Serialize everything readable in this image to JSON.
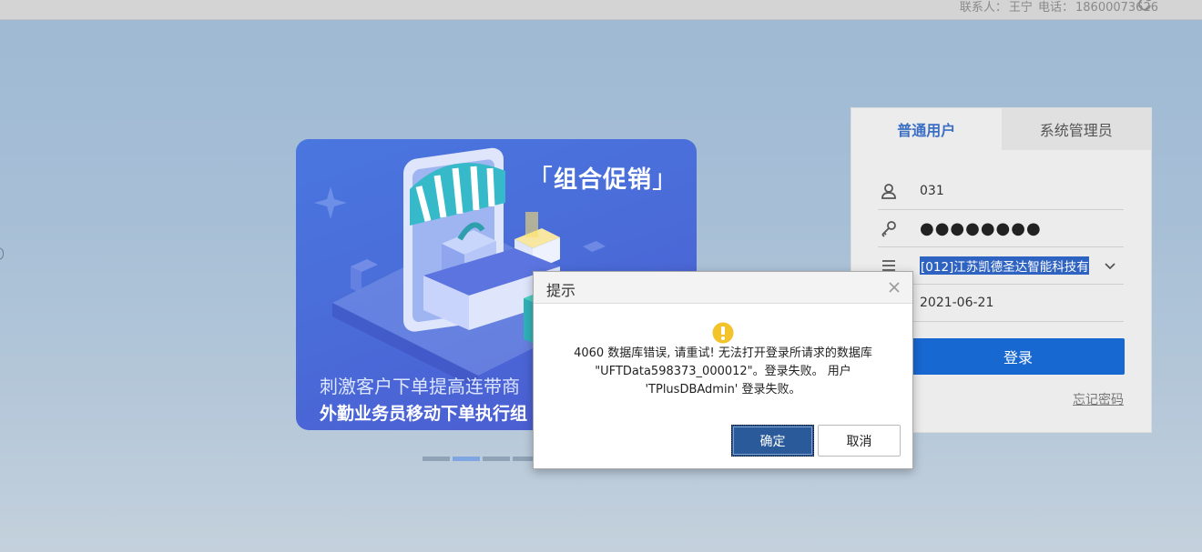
{
  "header": {
    "contact_label": "联系人：",
    "contact_name": "王宁",
    "phone_label": "电话：",
    "phone_number": "18600073626",
    "refresh_icon": "refresh-icon"
  },
  "banner": {
    "title": "组合促销",
    "title_open": "「",
    "title_close": "」",
    "line1": "刺激客户下单提高连带商",
    "line2": "外勤业务员移动下单执行组"
  },
  "carousel": {
    "slides": 5,
    "active_index": 1
  },
  "login": {
    "tabs": [
      {
        "label": "普通用户",
        "active": true
      },
      {
        "label": "系统管理员",
        "active": false
      }
    ],
    "username": "031",
    "password_mask": "●●●●●●●●",
    "account": "[012]江苏凯德圣达智能科技有",
    "date": "2021-06-21",
    "login_button": "登录",
    "forgot_link": "忘记密码"
  },
  "dialog": {
    "title": "提示",
    "message_line1": "4060 数据库错误, 请重试! 无法打开登录所请求的数据库",
    "message_line2": "\"UFTData598373_000012\"。登录失败。 用户",
    "message_line3": "'TPlusDBAdmin' 登录失败。",
    "ok_button": "确定",
    "cancel_button": "取消"
  },
  "colors": {
    "primary": "#1868d2",
    "warning": "#f2c32a",
    "tab_active": "#3c6fc4"
  }
}
